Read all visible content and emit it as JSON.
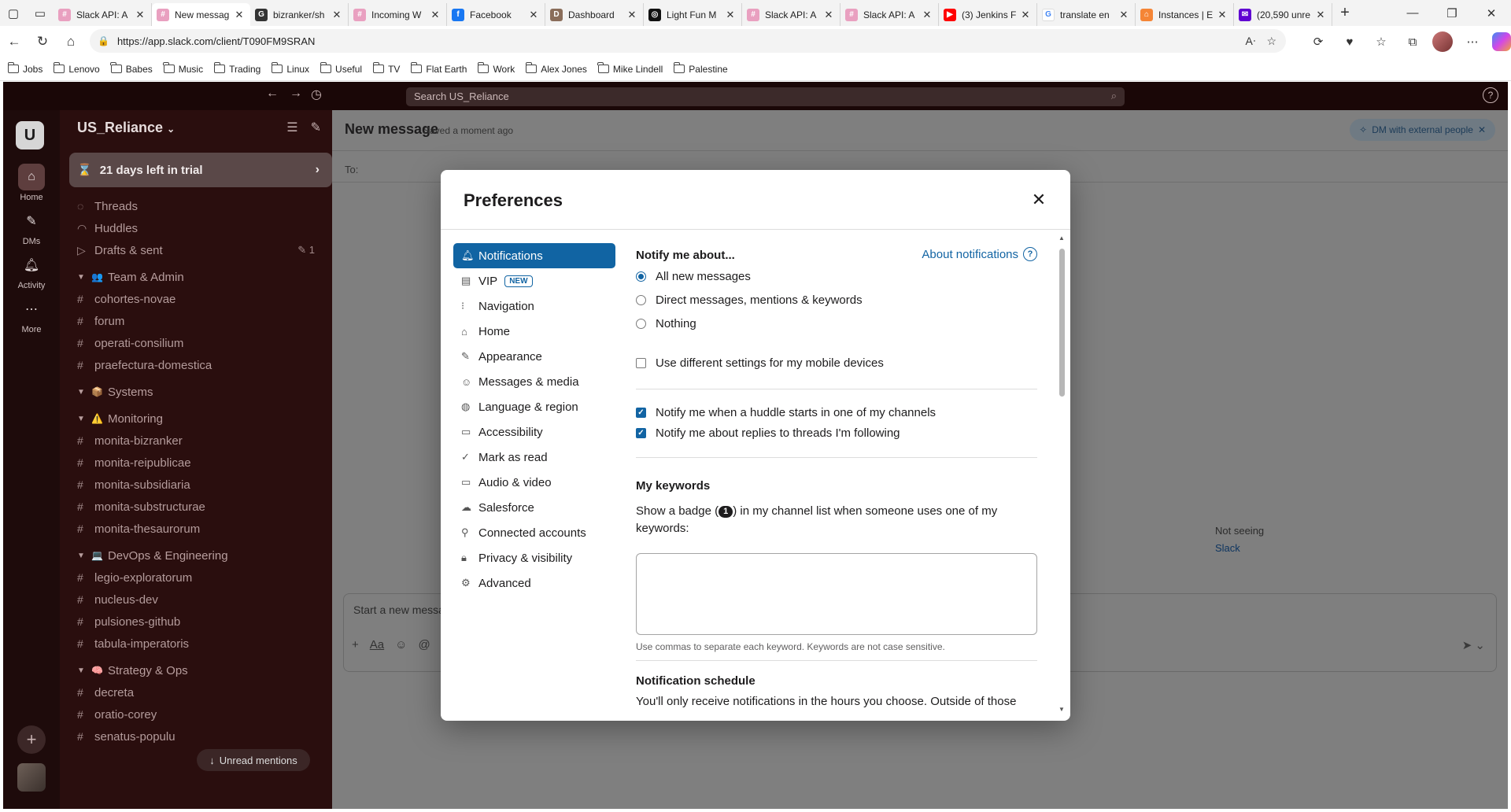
{
  "browser": {
    "tabs": [
      {
        "label": "Slack API: A",
        "favicon_color": "#e9a0c0",
        "favicon_text": "#"
      },
      {
        "label": "New messag",
        "favicon_color": "#e9a0c0",
        "favicon_text": "#",
        "active": true
      },
      {
        "label": "bizranker/sh",
        "favicon_color": "#333333",
        "favicon_text": "G"
      },
      {
        "label": "Incoming W",
        "favicon_color": "#e9a0c0",
        "favicon_text": "#"
      },
      {
        "label": "Facebook",
        "favicon_color": "#1877f2",
        "favicon_text": "f"
      },
      {
        "label": "Dashboard",
        "favicon_color": "#8a6d5a",
        "favicon_text": "D"
      },
      {
        "label": "Light Fun M",
        "favicon_color": "#111111",
        "favicon_text": "◎"
      },
      {
        "label": "Slack API: A",
        "favicon_color": "#e9a0c0",
        "favicon_text": "#"
      },
      {
        "label": "Slack API: A",
        "favicon_color": "#e9a0c0",
        "favicon_text": "#"
      },
      {
        "label": "(3) Jenkins F",
        "favicon_color": "#ff0000",
        "favicon_text": "▶"
      },
      {
        "label": "translate en",
        "favicon_color": "#ffffff",
        "favicon_text": "G"
      },
      {
        "label": "Instances | E",
        "favicon_color": "#f58536",
        "favicon_text": "⌂"
      },
      {
        "label": "(20,590 unre",
        "favicon_color": "#6001d2",
        "favicon_text": "✉"
      }
    ],
    "url": "https://app.slack.com/client/T090FM9SRAN",
    "bookmarks": [
      "Jobs",
      "Lenovo",
      "Babes",
      "Music",
      "Trading",
      "Linux",
      "Useful",
      "TV",
      "Flat Earth",
      "Work",
      "Alex Jones",
      "Mike Lindell",
      "Palestine"
    ]
  },
  "slack": {
    "search_placeholder": "Search US_Reliance",
    "workspace_initial": "U",
    "workspace_name": "US_Reliance",
    "rail": [
      {
        "label": "Home",
        "icon": "home-icon"
      },
      {
        "label": "DMs",
        "icon": "dms-icon"
      },
      {
        "label": "Activity",
        "icon": "bell-icon"
      },
      {
        "label": "More",
        "icon": "more-icon"
      }
    ],
    "trial_text": "21 days left in trial",
    "nav_items": [
      {
        "label": "Threads",
        "icon": "threads-icon"
      },
      {
        "label": "Huddles",
        "icon": "headphones-icon"
      },
      {
        "label": "Drafts & sent",
        "icon": "send-icon",
        "badge": "1"
      }
    ],
    "sections": [
      {
        "name": "Team & Admin",
        "emoji": "👥",
        "channels": [
          "cohortes-novae",
          "forum",
          "operati-consilium",
          "praefectura-domestica"
        ]
      },
      {
        "name": "Systems",
        "emoji": "📦",
        "channels": []
      },
      {
        "name": "Monitoring",
        "emoji": "⚠️",
        "channels": [
          "monita-bizranker",
          "monita-reipublicae",
          "monita-subsidiaria",
          "monita-substructurae",
          "monita-thesaurorum"
        ]
      },
      {
        "name": "DevOps & Engineering",
        "emoji": "💻",
        "channels": [
          "legio-exploratorum",
          "nucleus-dev",
          "pulsiones-github",
          "tabula-imperatoris"
        ]
      },
      {
        "name": "Strategy & Ops",
        "emoji": "🧠",
        "channels": [
          "decreta",
          "oratio-corey",
          "senatus-populu"
        ]
      }
    ],
    "unread_mentions": "Unread mentions",
    "main": {
      "title": "New message",
      "saved": "Saved a moment ago",
      "dm_external": "DM with external people",
      "to_label": "To:",
      "not_seeing": "Not seeing",
      "slack_link": "Slack",
      "composer_placeholder": "Start a new message"
    }
  },
  "modal": {
    "title": "Preferences",
    "nav": [
      {
        "label": "Notifications",
        "icon": "bell-icon",
        "active": true
      },
      {
        "label": "VIP",
        "icon": "vip-icon",
        "badge": "NEW"
      },
      {
        "label": "Navigation",
        "icon": "navigation-icon"
      },
      {
        "label": "Home",
        "icon": "home-icon"
      },
      {
        "label": "Appearance",
        "icon": "brush-icon"
      },
      {
        "label": "Messages & media",
        "icon": "message-icon"
      },
      {
        "label": "Language & region",
        "icon": "globe-icon"
      },
      {
        "label": "Accessibility",
        "icon": "accessibility-icon"
      },
      {
        "label": "Mark as read",
        "icon": "check-circle-icon"
      },
      {
        "label": "Audio & video",
        "icon": "video-icon"
      },
      {
        "label": "Salesforce",
        "icon": "cloud-icon"
      },
      {
        "label": "Connected accounts",
        "icon": "link-icon"
      },
      {
        "label": "Privacy & visibility",
        "icon": "lock-icon"
      },
      {
        "label": "Advanced",
        "icon": "gear-icon"
      }
    ],
    "notify_title": "Notify me about...",
    "about_link": "About notifications",
    "radio_options": [
      {
        "label": "All new messages",
        "selected": true
      },
      {
        "label": "Direct messages, mentions & keywords",
        "selected": false
      },
      {
        "label": "Nothing",
        "selected": false
      }
    ],
    "mobile_checkbox": {
      "label": "Use different settings for my mobile devices",
      "checked": false
    },
    "checkboxes": [
      {
        "label": "Notify me when a huddle starts in one of my channels",
        "checked": true
      },
      {
        "label": "Notify me about replies to threads I'm following",
        "checked": true
      }
    ],
    "keywords_title": "My keywords",
    "keywords_desc_before": "Show a badge (",
    "keywords_badge": "1",
    "keywords_desc_after": ") in my channel list when someone uses one of my keywords:",
    "keywords_value": "",
    "keywords_hint": "Use commas to separate each keyword. Keywords are not case sensitive.",
    "schedule_title": "Notification schedule",
    "schedule_desc": "You'll only receive notifications in the hours you choose. Outside of those"
  },
  "colors": {
    "accent": "#1264a3",
    "active_nav": "#1164a3",
    "sidebar_bg": "#2a0e0e"
  }
}
